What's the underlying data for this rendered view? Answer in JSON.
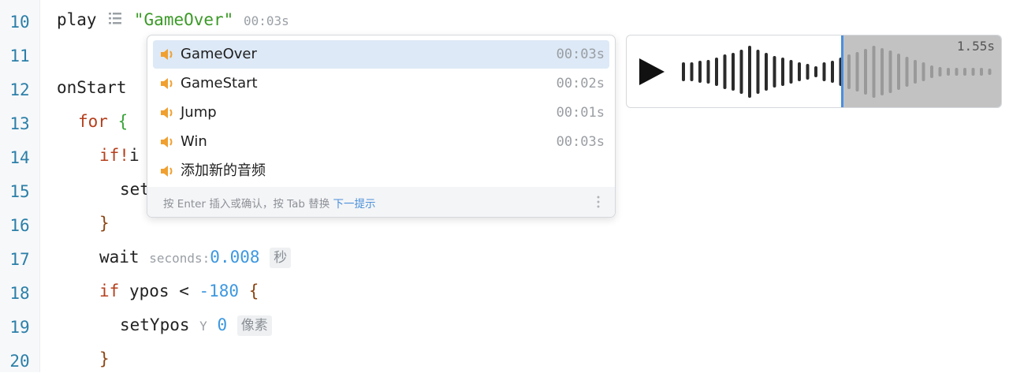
{
  "lines": [
    "10",
    "11",
    "12",
    "13",
    "14",
    "15",
    "16",
    "17",
    "18",
    "19",
    "20"
  ],
  "code": {
    "l10_play": "play",
    "l10_sound": "\"GameOver\"",
    "l10_duration": "00:03s",
    "l12_onstart": "onStart",
    "l13_for": "for",
    "l13_brace": "{",
    "l14_if": "if",
    "l14_bang": "!i",
    "l15_set": "set",
    "l16_brace": "}",
    "l17_wait": "wait",
    "l17_param": "seconds:",
    "l17_value": "0.008",
    "l17_unit": "秒",
    "l18_if": "if",
    "l18_var": "ypos",
    "l18_op": "<",
    "l18_value": "-180",
    "l18_brace": "{",
    "l19_fn": "setYpos",
    "l19_param": "Y",
    "l19_value": "0",
    "l19_unit": "像素",
    "l20_brace": "}"
  },
  "dropdown": {
    "items": [
      {
        "name": "GameOver",
        "duration": "00:03s",
        "selected": true
      },
      {
        "name": "GameStart",
        "duration": "00:02s",
        "selected": false
      },
      {
        "name": "Jump",
        "duration": "00:01s",
        "selected": false
      },
      {
        "name": "Win",
        "duration": "00:03s",
        "selected": false
      },
      {
        "name": "添加新的音频",
        "duration": "",
        "selected": false
      }
    ],
    "footer_text": "按 Enter 插入或确认，按 Tab 替换 ",
    "footer_link": "下一提示",
    "item_icon": "speaker-icon",
    "more_icon": "vertical-ellipsis-icon"
  },
  "preview": {
    "time": "1.55s",
    "playhead_fraction": 0.57,
    "play_icon": "play-icon"
  },
  "colors": {
    "line_numbers": "#2b7fa8",
    "keyword": "#b5401d",
    "string": "#3c9a28",
    "number": "#3d98e0",
    "selection": "#dde9f6",
    "speaker": "#f0a030",
    "playhead": "#4a8ee0"
  }
}
